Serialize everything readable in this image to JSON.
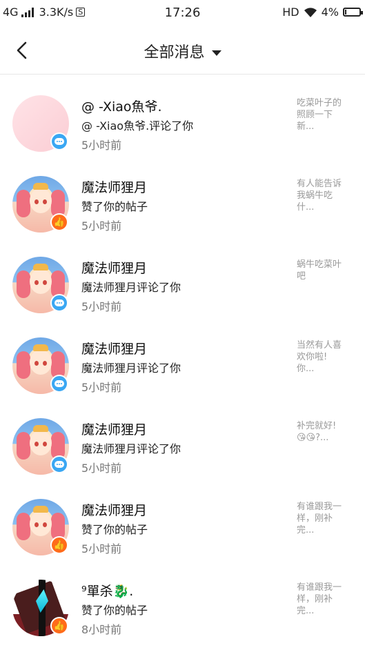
{
  "status_bar": {
    "network": "4G",
    "speed": "3.3K/s",
    "sim_icon": "S",
    "time": "17:26",
    "hd": "HD",
    "battery": "4%"
  },
  "header": {
    "title": "全部消息"
  },
  "messages": [
    {
      "name": "@          -Xiao魚爷.",
      "text": "@          -Xiao魚爷.评论了你",
      "time": "5小时前",
      "preview": "吃菜叶子的\n照顾一下\n新...",
      "action_icon": "comment-icon"
    },
    {
      "name": "魔法师狸月",
      "text": "赞了你的帖子",
      "time": "5小时前",
      "preview": "有人能告诉\n我蜗牛吃\n什...",
      "action_icon": "like-icon"
    },
    {
      "name": "魔法师狸月",
      "text": "魔法师狸月评论了你",
      "time": "5小时前",
      "preview": "蜗牛吃菜叶\n吧",
      "action_icon": "comment-icon"
    },
    {
      "name": "魔法师狸月",
      "text": "魔法师狸月评论了你",
      "time": "5小时前",
      "preview": "当然有人喜\n欢你啦!\n你...",
      "action_icon": "comment-icon"
    },
    {
      "name": "魔法师狸月",
      "text": "魔法师狸月评论了你",
      "time": "5小时前",
      "preview": "补完就好!\n😘😘?...",
      "action_icon": "comment-icon"
    },
    {
      "name": "魔法师狸月",
      "text": "赞了你的帖子",
      "time": "5小时前",
      "preview": "有谁跟我一\n样，刚补\n完...",
      "action_icon": "like-icon"
    },
    {
      "name": "⁹單杀🐉.",
      "text": "赞了你的帖子",
      "time": "8小时前",
      "preview": "有谁跟我一\n样，刚补\n完...",
      "action_icon": "like-icon"
    }
  ]
}
